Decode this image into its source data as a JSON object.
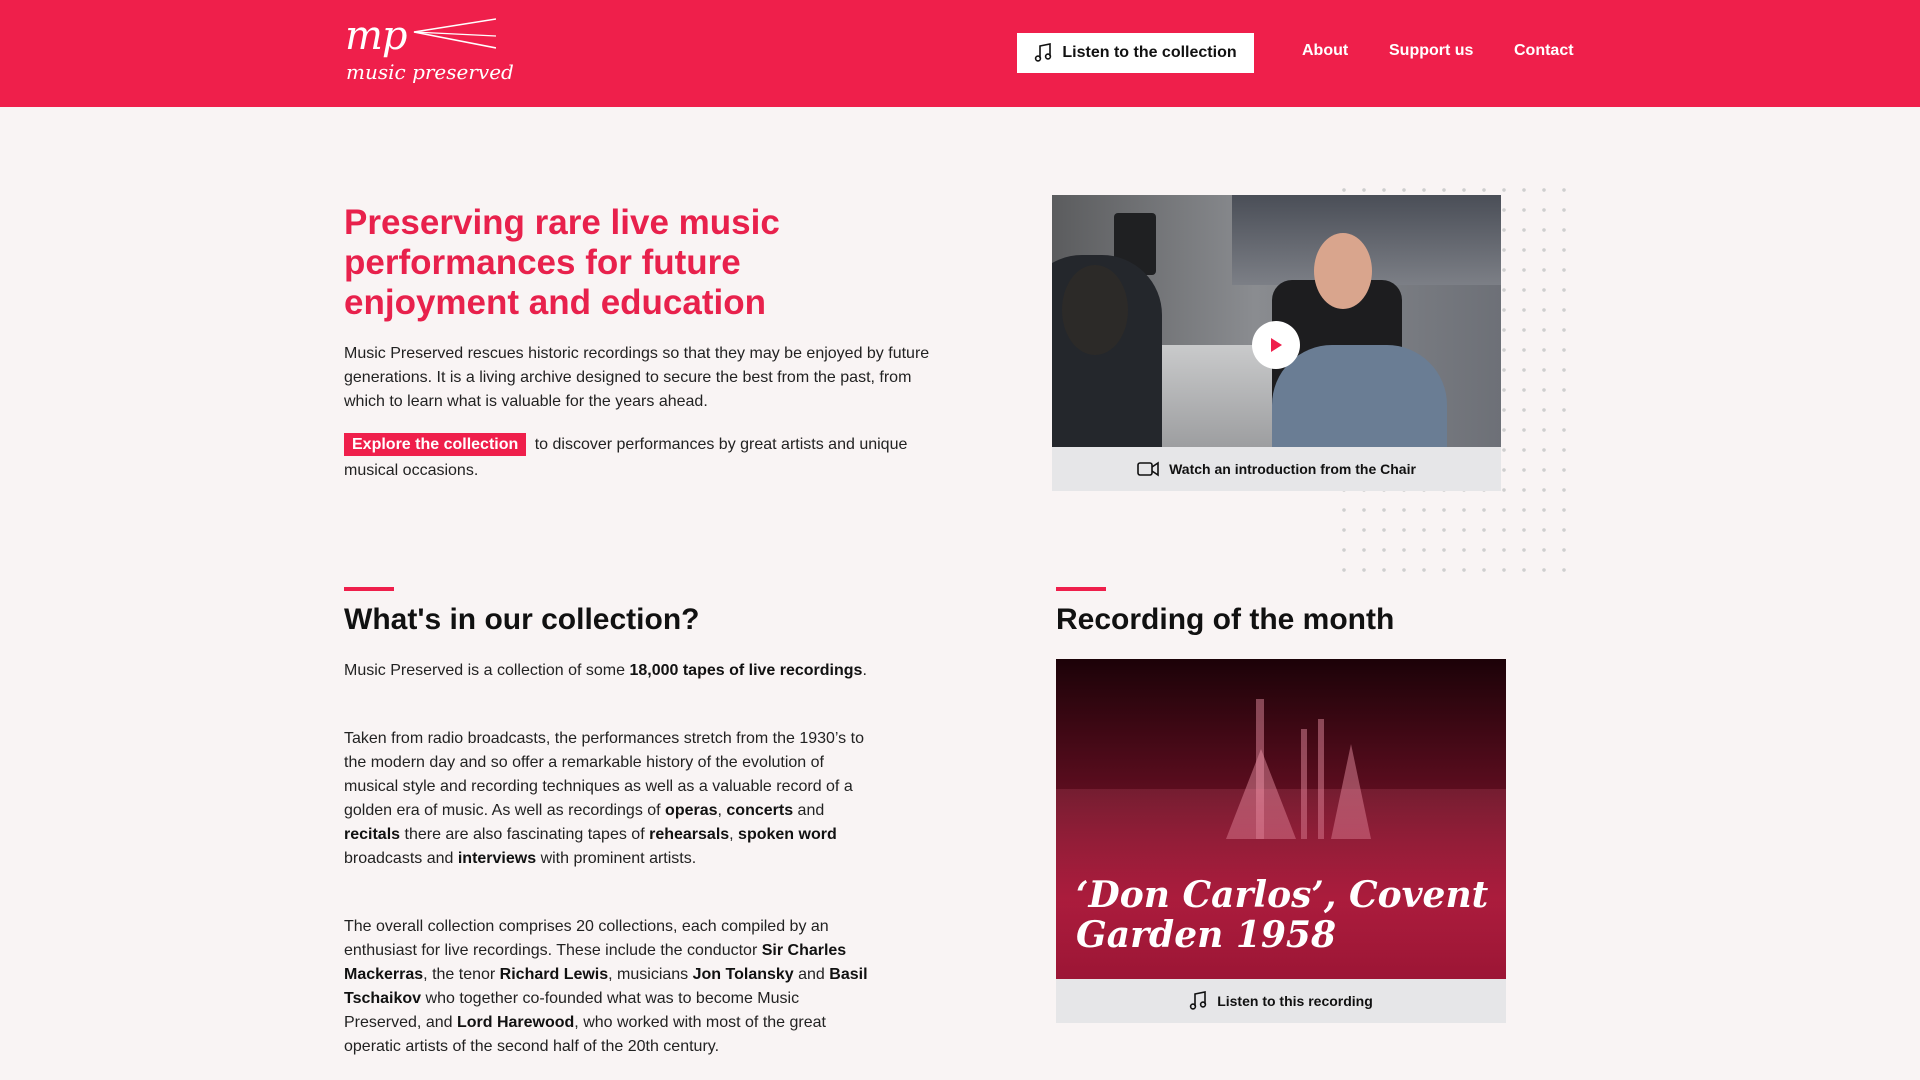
{
  "brand": {
    "logo_mark": "mp",
    "logo_word": "music preserved",
    "accent": "#ef1f4b"
  },
  "nav": {
    "listen_label": "Listen to the collection",
    "listen_icon": "music-note-icon",
    "about": "About",
    "support": "Support us",
    "contact": "Contact"
  },
  "hero": {
    "title": "Preserving rare live music performances for future enjoyment and education",
    "intro": "Music Preserved rescues historic recordings so that they may be enjoyed by future generations. It is a living archive designed to secure the best from the past, from which to learn what is valuable for the years ahead.",
    "explore_label": "Explore the collection",
    "explore_rest": "to discover performances by great artists and unique musical occasions."
  },
  "video": {
    "caption": "Watch an introduction from the Chair",
    "caption_icon": "video-camera-icon",
    "play_icon": "play-icon"
  },
  "collection": {
    "title": "What's in our collection?",
    "p1_a": "Music Preserved is a collection of some ",
    "p1_b": "18,000 tapes of live recordings",
    "p1_c": ".",
    "p2_a": "Taken from radio broadcasts, the performances stretch from the 1930’s to the modern day and so offer a remarkable history of the evolution of musical style and recording techniques as well as a valuable record of a golden era of music. As well as recordings of ",
    "p2_operas": "operas",
    "p2_sep1": ", ",
    "p2_concerts": "concerts",
    "p2_and1": " and ",
    "p2_recitals": "recitals",
    "p2_b": " there are also fascinating tapes of ",
    "p2_rehearsals": "rehearsals",
    "p2_sep2": ", ",
    "p2_spoken": "spoken word",
    "p2_c": " broadcasts and ",
    "p2_interviews": "interviews",
    "p2_d": " with prominent artists.",
    "p3_a": "The overall collection comprises 20 collections, each compiled by an enthusiast for live recordings. These include the conductor ",
    "p3_mackerras": "Sir Charles Mackerras",
    "p3_b": ", the tenor ",
    "p3_lewis": "Richard Lewis",
    "p3_c": ", musicians ",
    "p3_tolansky": "Jon Tolansky",
    "p3_and": " and ",
    "p3_tschaikov": "Basil Tschaikov",
    "p3_d": " who together co-founded what was to become Music Preserved, and ",
    "p3_harewood": "Lord Harewood",
    "p3_e": ", who worked with most of the great operatic artists of the second half of the 20th century."
  },
  "recording": {
    "section_title": "Recording of the month",
    "image_title": "‘Don Carlos’, Covent Garden 1958",
    "listen_label": "Listen to this recording",
    "listen_icon": "music-note-icon"
  }
}
